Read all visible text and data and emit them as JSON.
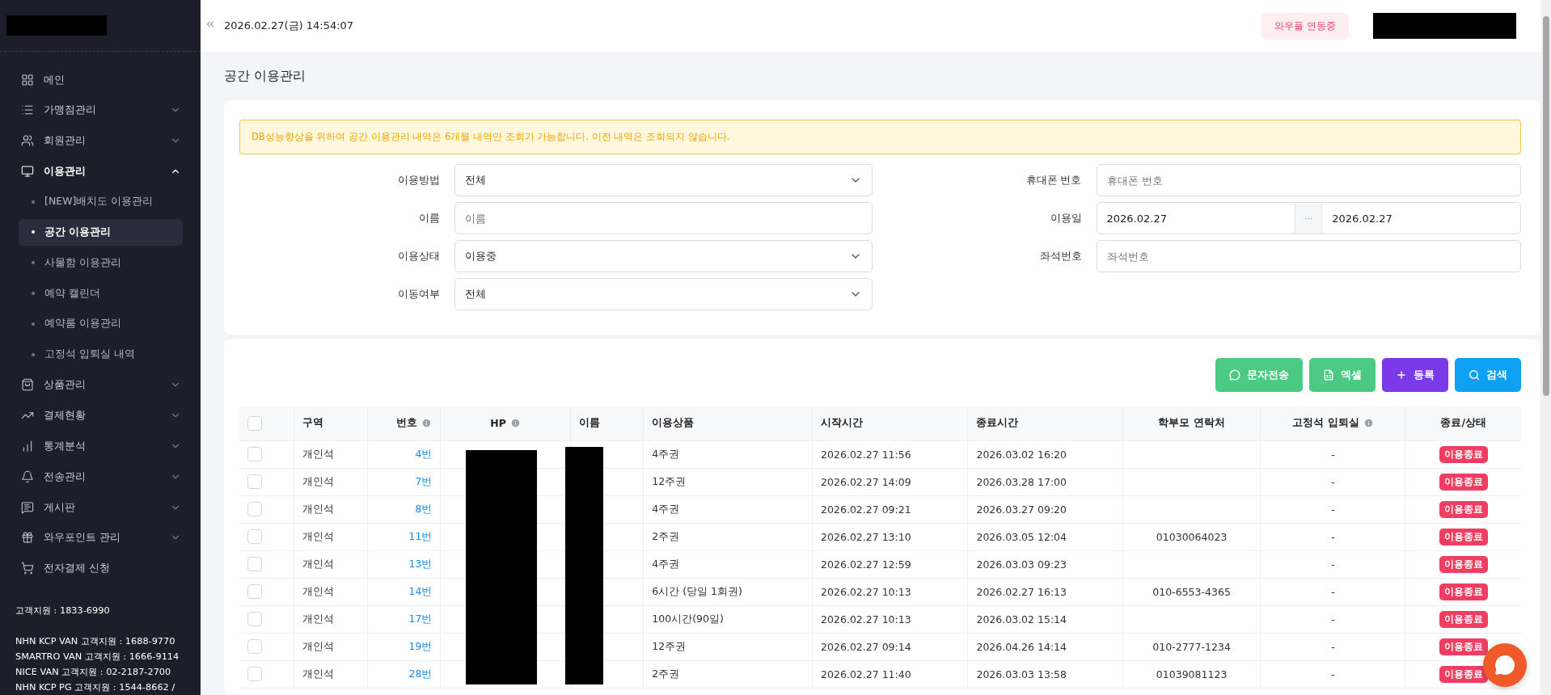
{
  "sidebar": {
    "items": [
      {
        "label": "메인"
      },
      {
        "label": "가맹점관리",
        "expanded": false
      },
      {
        "label": "회원관리",
        "expanded": false
      },
      {
        "label": "이용관리",
        "expanded": true,
        "children": [
          {
            "label": "[NEW]배치도 이용관리",
            "selected": false
          },
          {
            "label": "공간 이용관리",
            "selected": true
          },
          {
            "label": "사물함 이용관리",
            "selected": false
          },
          {
            "label": "예약 캘린더",
            "selected": false
          },
          {
            "label": "예약룸 이용관리",
            "selected": false
          },
          {
            "label": "고정석 입퇴실 내역",
            "selected": false
          }
        ]
      },
      {
        "label": "상품관리",
        "expanded": false
      },
      {
        "label": "결제현황",
        "expanded": false
      },
      {
        "label": "통계분석",
        "expanded": false
      },
      {
        "label": "전송관리",
        "expanded": false
      },
      {
        "label": "게시판",
        "expanded": false
      },
      {
        "label": "와우포인트 관리",
        "expanded": false
      },
      {
        "label": "전자결제 신청"
      }
    ],
    "support": "고객지원 : 1833-6990",
    "contacts": [
      "NHN KCP VAN 고객지원 : 1688-9770",
      "SMARTRO VAN 고객지원 : 1666-9114",
      "NICE VAN 고객지원 : 02-2187-2700",
      "NHN KCP PG 고객지원 : 1544-8662 /"
    ]
  },
  "header": {
    "datetime": "2026.02.27(금) 14:54:07",
    "badge": "와우플 연동중"
  },
  "page_title": "공간 이용관리",
  "notice": "DB성능향상을 위하여 공간 이용관리 내역은 6개월 내역만 조회가 가능합니다. 이전 내역은 조회되지 않습니다.",
  "filters": {
    "left": [
      {
        "label": "이용방법",
        "kind": "select",
        "value": "전체"
      },
      {
        "label": "이름",
        "kind": "text",
        "placeholder": "이름"
      },
      {
        "label": "이용상태",
        "kind": "select",
        "value": "이용중"
      },
      {
        "label": "이동여부",
        "kind": "select",
        "value": "전체"
      }
    ],
    "right": [
      {
        "label": "휴대폰 번호",
        "kind": "text",
        "placeholder": "휴대폰 번호"
      },
      {
        "label": "이용일",
        "kind": "daterange",
        "from": "2026.02.27",
        "separator": "···",
        "to": "2026.02.27"
      },
      {
        "label": "좌석번호",
        "kind": "text",
        "placeholder": "좌석번호"
      }
    ]
  },
  "actions": [
    {
      "label": "문자전송",
      "kind": "sms"
    },
    {
      "label": "엑셀",
      "kind": "excel"
    },
    {
      "label": "등록",
      "kind": "add"
    },
    {
      "label": "검색",
      "kind": "search"
    }
  ],
  "table": {
    "all_checked": false,
    "columns": [
      {
        "label": "구역",
        "info": false
      },
      {
        "label": "번호",
        "info": true
      },
      {
        "label": "HP",
        "info": true
      },
      {
        "label": "이름",
        "info": false
      },
      {
        "label": "이용상품",
        "info": false
      },
      {
        "label": "시작시간",
        "info": false
      },
      {
        "label": "종료시간",
        "info": false
      },
      {
        "label": "학부모 연락처",
        "info": false
      },
      {
        "label": "고정석 입퇴실",
        "info": true
      },
      {
        "label": "종료/상태",
        "info": false
      }
    ],
    "rows": [
      {
        "checked": false,
        "zone": "개인석",
        "number": "4번",
        "product": "4주권",
        "start": "2026.02.27 11:56",
        "end": "2026.03.02 16:20",
        "parent": "",
        "fixed": "-",
        "status": "이용종료"
      },
      {
        "checked": false,
        "zone": "개인석",
        "number": "7번",
        "product": "12주권",
        "start": "2026.02.27 14:09",
        "end": "2026.03.28 17:00",
        "parent": "",
        "fixed": "-",
        "status": "이용종료"
      },
      {
        "checked": false,
        "zone": "개인석",
        "number": "8번",
        "product": "4주권",
        "start": "2026.02.27 09:21",
        "end": "2026.03.27 09:20",
        "parent": "",
        "fixed": "-",
        "status": "이용종료"
      },
      {
        "checked": false,
        "zone": "개인석",
        "number": "11번",
        "product": "2주권",
        "start": "2026.02.27 13:10",
        "end": "2026.03.05 12:04",
        "parent": "01030064023",
        "fixed": "-",
        "status": "이용종료"
      },
      {
        "checked": false,
        "zone": "개인석",
        "number": "13번",
        "product": "4주권",
        "start": "2026.02.27 12:59",
        "end": "2026.03.03 09:23",
        "parent": "",
        "fixed": "-",
        "status": "이용종료"
      },
      {
        "checked": false,
        "zone": "개인석",
        "number": "14번",
        "product": "6시간 (당일 1회권)",
        "start": "2026.02.27 10:13",
        "end": "2026.02.27 16:13",
        "parent": "010-6553-4365",
        "fixed": "-",
        "status": "이용종료"
      },
      {
        "checked": false,
        "zone": "개인석",
        "number": "17번",
        "product": "100시간(90일)",
        "start": "2026.02.27 10:13",
        "end": "2026.03.02 15:14",
        "parent": "",
        "fixed": "-",
        "status": "이용종료"
      },
      {
        "checked": false,
        "zone": "개인석",
        "number": "19번",
        "product": "12주권",
        "start": "2026.02.27 09:14",
        "end": "2026.04.26 14:14",
        "parent": "010-2777-1234",
        "fixed": "-",
        "status": "이용종료"
      },
      {
        "checked": false,
        "zone": "개인석",
        "number": "28번",
        "product": "2주권",
        "start": "2026.02.27 11:40",
        "end": "2026.03.03 13:58",
        "parent": "01039081123",
        "fixed": "-",
        "status": "이용종료"
      }
    ]
  }
}
